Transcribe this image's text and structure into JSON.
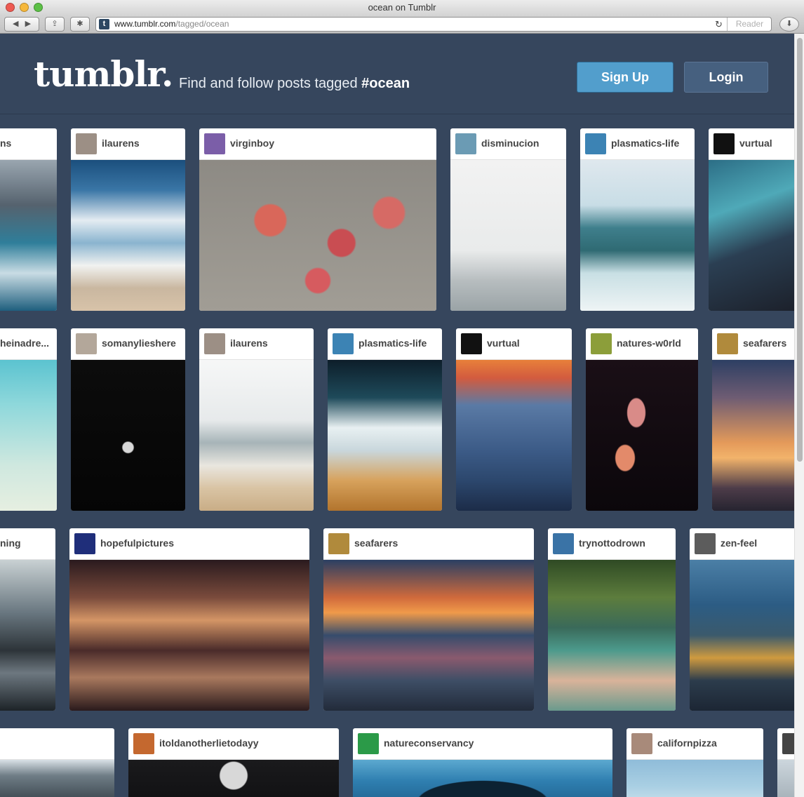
{
  "browser": {
    "title": "ocean on Tumblr",
    "url_host": "www.tumblr.com",
    "url_path": "/tagged/ocean",
    "reader_label": "Reader"
  },
  "header": {
    "logo": "tumblr.",
    "tagline_prefix": "Find and follow posts tagged",
    "tag": "#ocean",
    "signup_label": "Sign Up",
    "login_label": "Login"
  },
  "posts": [
    {
      "user": "ns",
      "avatar": "#6b7788",
      "photo": "linear-gradient(180deg,#9aa6b0 0%,#55626e 30%,#2f7e9a 55%,#c9dce4 75%,#1f5f7e 100%)"
    },
    {
      "user": "ilaurens",
      "avatar": "#9c8f85",
      "photo": "linear-gradient(180deg,#1b4f7d 0%,#3a76a6 20%,#e4ecf2 40%,#8ab4cf 55%,#f1f2f0 70%,#c9b7a0 85%,#d8c3a9 100%)"
    },
    {
      "user": "virginboy",
      "avatar": "#7b5ea8",
      "photo": "radial-gradient(circle at 30% 40%,#d9675a 0 8%,transparent 9%),radial-gradient(circle at 60% 55%,#c94d52 0 8%,transparent 9%),radial-gradient(circle at 80% 35%,#d66a65 0 7%,transparent 8%),radial-gradient(circle at 50% 80%,#d65b5f 0 7%,transparent 8%),linear-gradient(180deg,#8d8a84,#a19d95)"
    },
    {
      "user": "disminucion",
      "avatar": "#6b9bb4",
      "photo": "linear-gradient(180deg,#f2f2f2 0%,#e9ebeb 60%,#b7bdbf 80%,#9aa3a6 100%)"
    },
    {
      "user": "plasmatics-life",
      "avatar": "#3c83b4",
      "photo": "linear-gradient(180deg,#dfe8ee 0%,#c8dde6 30%,#3f7f8c 45%,#2f6a73 60%,#c8dfe4 75%,#eef4f5 100%)"
    },
    {
      "user": "vurtual",
      "avatar": "#111111",
      "photo": "linear-gradient(160deg,#2c6e86 0%,#4fa9b8 30%,#2b3f53 55%,#1a1d26 100%)"
    },
    {
      "user": "heinadre...",
      "avatar": "#7aa9a4",
      "photo": "linear-gradient(180deg,#5bc3d0 0%,#8fd8db 30%,#cfe8df 70%,#e6efe1 100%)"
    },
    {
      "user": "somanylieshere",
      "avatar": "#b3a79a",
      "photo": "radial-gradient(circle at 50% 58%,#d8d8d8 0 5%,transparent 6%),linear-gradient(180deg,#0c0c0c,#050505)"
    },
    {
      "user": "ilaurens",
      "avatar": "#9c8f85",
      "photo": "linear-gradient(180deg,#f6f7f7 0%,#e7eaeb 40%,#a7b4b8 55%,#e9e6df 70%,#d9c4a4 85%,#c9ad86 100%)"
    },
    {
      "user": "plasmatics-life",
      "avatar": "#3c83b4",
      "photo": "linear-gradient(180deg,#0d1e2a 0%,#1e4a5a 25%,#e8f0f2 45%,#c9d7dc 60%,#d7a25c 80%,#b2742d 100%)"
    },
    {
      "user": "vurtual",
      "avatar": "#111111",
      "photo": "linear-gradient(180deg,#e8803a 0%,#d25b3f 12%,#5a7aa5 30%,#3c5b87 60%,#2c476d 80%,#1c2c48 100%)"
    },
    {
      "user": "natures-w0rld",
      "avatar": "#8c9e3a",
      "photo": "radial-gradient(ellipse at 45% 35%,#d98b88 0 10%,transparent 11%),radial-gradient(ellipse at 35% 65%,#e38a6a 0 9%,transparent 10%),linear-gradient(180deg,#1a0f16,#0b070b)"
    },
    {
      "user": "seafarers",
      "avatar": "#b08a3c",
      "photo": "linear-gradient(180deg,#2d3f63 0%,#6e5c73 25%,#e49a5a 55%,#f2b36b 65%,#4d3c49 85%,#262430 100%)"
    },
    {
      "user": "ning",
      "avatar": "#6f7d86",
      "photo": "linear-gradient(180deg,#c9d1d3 0%,#697780 35%,#2d3439 60%,#6d7880 75%,#1d2328 100%)"
    },
    {
      "user": "hopefulpictures",
      "avatar": "#1f2e7a",
      "photo": "linear-gradient(180deg,#2a1a1e 0%,#7a4b3c 25%,#d49566 40%,#4a2b2a 60%,#a9795e 78%,#2a1a1c 100%)"
    },
    {
      "user": "seafarers",
      "avatar": "#b08a3c",
      "photo": "linear-gradient(180deg,#2a3f63 0%,#d06a3c 25%,#f09a4a 35%,#364c6c 50%,#8a5a6e 65%,#3e4e66 80%,#222b3a 100%)"
    },
    {
      "user": "trynottodrown",
      "avatar": "#3a73a6",
      "photo": "linear-gradient(180deg,#2f4a24 0%,#5d7d3d 25%,#3a6a5a 45%,#4c9a8c 60%,#d9b39a 80%,#6a9a8d 100%)"
    },
    {
      "user": "zen-feel",
      "avatar": "#5c5c5c",
      "photo": "linear-gradient(180deg,#4b7fa6 0%,#2c5c84 30%,#3b5a6c 50%,#cf9a3f 65%,#2c3c4c 80%,#1c2634 100%)"
    },
    {
      "user": "",
      "avatar": "#ffffff",
      "photo": "linear-gradient(180deg,#d9e1e6 0%,#6f7d86 30%,#262f36 100%)"
    },
    {
      "user": "itoldanotherlietodayy",
      "avatar": "#c4682f",
      "photo": "radial-gradient(circle at 50% 30%,#d8d8d8 0 12%,transparent 13%),linear-gradient(180deg,#1a1a1c,#0f0f11)"
    },
    {
      "user": "natureconservancy",
      "avatar": "#2b9a48",
      "photo": "radial-gradient(ellipse at 50% 80%,#0c2232 0 35%,transparent 36%),linear-gradient(180deg,#5ca9d0 0%,#2f7fb0 40%,#1c5a87 100%)"
    },
    {
      "user": "californpizza",
      "avatar": "#a88a7a",
      "photo": "linear-gradient(180deg,#8fbcd9 0%,#a9cfe3 50%,#d6e8ef 100%)"
    },
    {
      "user": "",
      "avatar": "#444444",
      "photo": "linear-gradient(180deg,#ccd6dd,#9aa6ae)"
    }
  ]
}
